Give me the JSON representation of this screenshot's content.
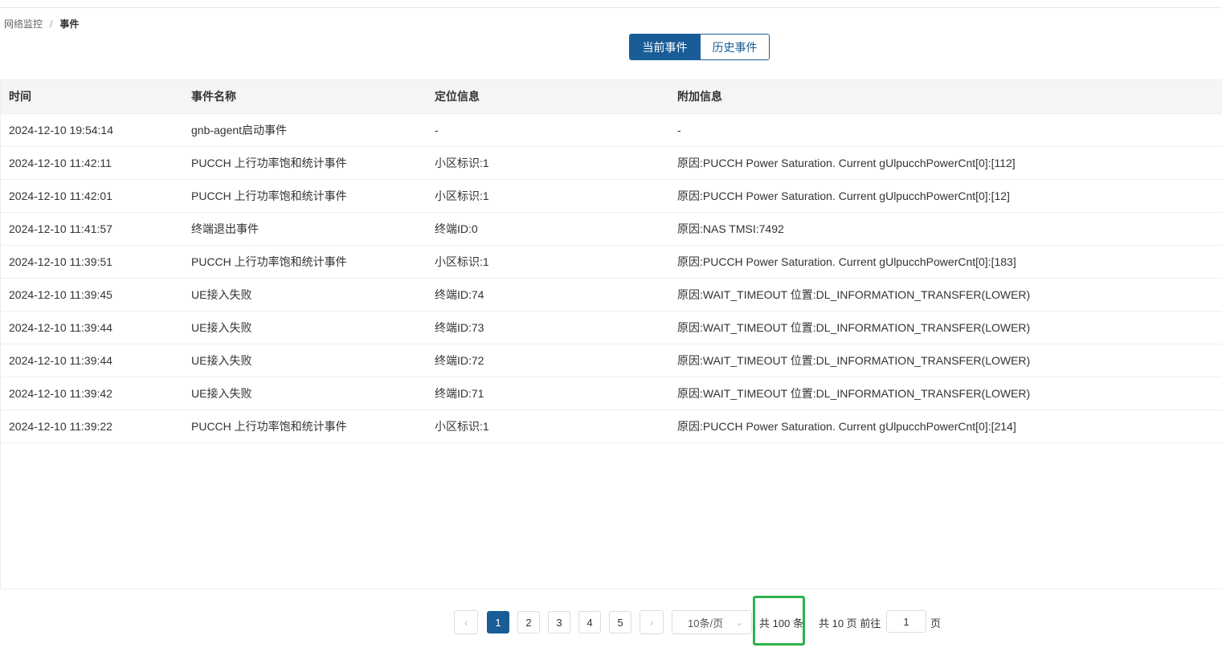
{
  "breadcrumb": {
    "parent": "网络监控",
    "separator": "/",
    "current": "事件"
  },
  "tabs": {
    "current": "当前事件",
    "history": "历史事件"
  },
  "table": {
    "headers": [
      "时间",
      "事件名称",
      "定位信息",
      "附加信息"
    ],
    "rows": [
      [
        "2024-12-10 19:54:14",
        "gnb-agent启动事件",
        "-",
        "-"
      ],
      [
        "2024-12-10 11:42:11",
        "PUCCH 上行功率饱和统计事件",
        "小区标识:1",
        "原因:PUCCH Power Saturation. Current gUlpucchPowerCnt[0]:[112]"
      ],
      [
        "2024-12-10 11:42:01",
        "PUCCH 上行功率饱和统计事件",
        "小区标识:1",
        "原因:PUCCH Power Saturation. Current gUlpucchPowerCnt[0]:[12]"
      ],
      [
        "2024-12-10 11:41:57",
        "终端退出事件",
        "终端ID:0",
        "原因:NAS TMSI:7492"
      ],
      [
        "2024-12-10 11:39:51",
        "PUCCH 上行功率饱和统计事件",
        "小区标识:1",
        "原因:PUCCH Power Saturation. Current gUlpucchPowerCnt[0]:[183]"
      ],
      [
        "2024-12-10 11:39:45",
        "UE接入失败",
        "终端ID:74",
        "原因:WAIT_TIMEOUT 位置:DL_INFORMATION_TRANSFER(LOWER)"
      ],
      [
        "2024-12-10 11:39:44",
        "UE接入失败",
        "终端ID:73",
        "原因:WAIT_TIMEOUT 位置:DL_INFORMATION_TRANSFER(LOWER)"
      ],
      [
        "2024-12-10 11:39:44",
        "UE接入失败",
        "终端ID:72",
        "原因:WAIT_TIMEOUT 位置:DL_INFORMATION_TRANSFER(LOWER)"
      ],
      [
        "2024-12-10 11:39:42",
        "UE接入失败",
        "终端ID:71",
        "原因:WAIT_TIMEOUT 位置:DL_INFORMATION_TRANSFER(LOWER)"
      ],
      [
        "2024-12-10 11:39:22",
        "PUCCH 上行功率饱和统计事件",
        "小区标识:1",
        "原因:PUCCH Power Saturation. Current gUlpucchPowerCnt[0]:[214]"
      ]
    ]
  },
  "pagination": {
    "prev_icon": "chevron-left-icon",
    "next_icon": "chevron-right-icon",
    "pages": [
      "1",
      "2",
      "3",
      "4",
      "5"
    ],
    "active_page": "1",
    "page_size": "10条/页",
    "total": "共 100 条",
    "page_count": "共 10 页",
    "goto_label": "前往",
    "goto_value": "1",
    "page_suffix": "页"
  },
  "colors": {
    "accent": "#1a5d96",
    "highlight_box": "#2eb24a"
  }
}
